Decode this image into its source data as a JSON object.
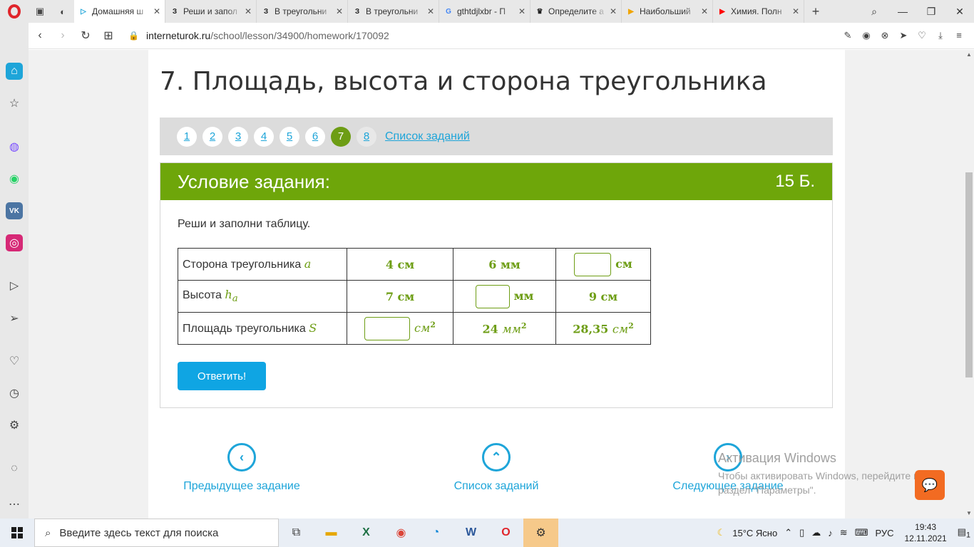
{
  "browser": {
    "tabs": [
      {
        "label": "Домашняя ш",
        "favicon": "▷",
        "favicon_color": "#1ea5d9",
        "active": true
      },
      {
        "label": "Реши и запол",
        "favicon": "З",
        "favicon_color": "#222",
        "active": false
      },
      {
        "label": "В треугольни",
        "favicon": "З",
        "favicon_color": "#222",
        "active": false
      },
      {
        "label": "В треугольни",
        "favicon": "З",
        "favicon_color": "#222",
        "active": false
      },
      {
        "label": "gthtdjlxbr - П",
        "favicon": "G",
        "favicon_color": "#4285f4",
        "active": false
      },
      {
        "label": "Определите а",
        "favicon": "♛",
        "favicon_color": "#222",
        "active": false
      },
      {
        "label": "Наибольший",
        "favicon": "▶",
        "favicon_color": "#f0a500",
        "active": false
      },
      {
        "label": "Химия. Полн",
        "favicon": "▶",
        "favicon_color": "#ff0000",
        "active": false
      }
    ],
    "url_host": "interneturok.ru",
    "url_path": "/school/lesson/34900/homework/170092"
  },
  "lesson": {
    "title": "7. Площадь, высота и сторона треугольника",
    "pages": [
      "1",
      "2",
      "3",
      "4",
      "5",
      "6",
      "7",
      "8"
    ],
    "active_page": "7",
    "task_list_link": "Список заданий"
  },
  "task": {
    "header": "Условие задания:",
    "score": "15 Б.",
    "text": "Реши и заполни таблицу.",
    "rows": {
      "side_label": "Сторона треугольника ",
      "side_var": "a",
      "height_label": "Высота ",
      "height_var": "h",
      "height_sub": "a",
      "area_label": "Площадь треугольника ",
      "area_var": "S"
    },
    "cells": {
      "r1c1": "4 см",
      "r1c2": "6 мм",
      "r1c3_unit": "см",
      "r2c1": "7 см",
      "r2c2_unit": "мм",
      "r2c3": "9 см",
      "r3c1_unit": "см",
      "r3c1_exp": "2",
      "r3c2_num": "24",
      "r3c2_unit": "мм",
      "r3c2_exp": "2",
      "r3c3_num": "28,35",
      "r3c3_unit": "см",
      "r3c3_exp": "2"
    },
    "submit": "Ответить!"
  },
  "bottom_nav": {
    "prev": "Предыдущее задание",
    "list": "Список заданий",
    "next": "Следующее задание"
  },
  "watermark": {
    "title": "Активация Windows",
    "line1": "Чтобы активировать Windows, перейдите в",
    "line2": "раздел \"Параметры\"."
  },
  "taskbar": {
    "search_placeholder": "Введите здесь текст для поиска",
    "weather": "15°C  Ясно",
    "lang": "РУС",
    "time": "19:43",
    "date": "12.11.2021",
    "notif_count": "1"
  },
  "colors": {
    "accent_green": "#6ea60a",
    "link_blue": "#1ea5d9",
    "button_blue": "#0fa5e3"
  }
}
